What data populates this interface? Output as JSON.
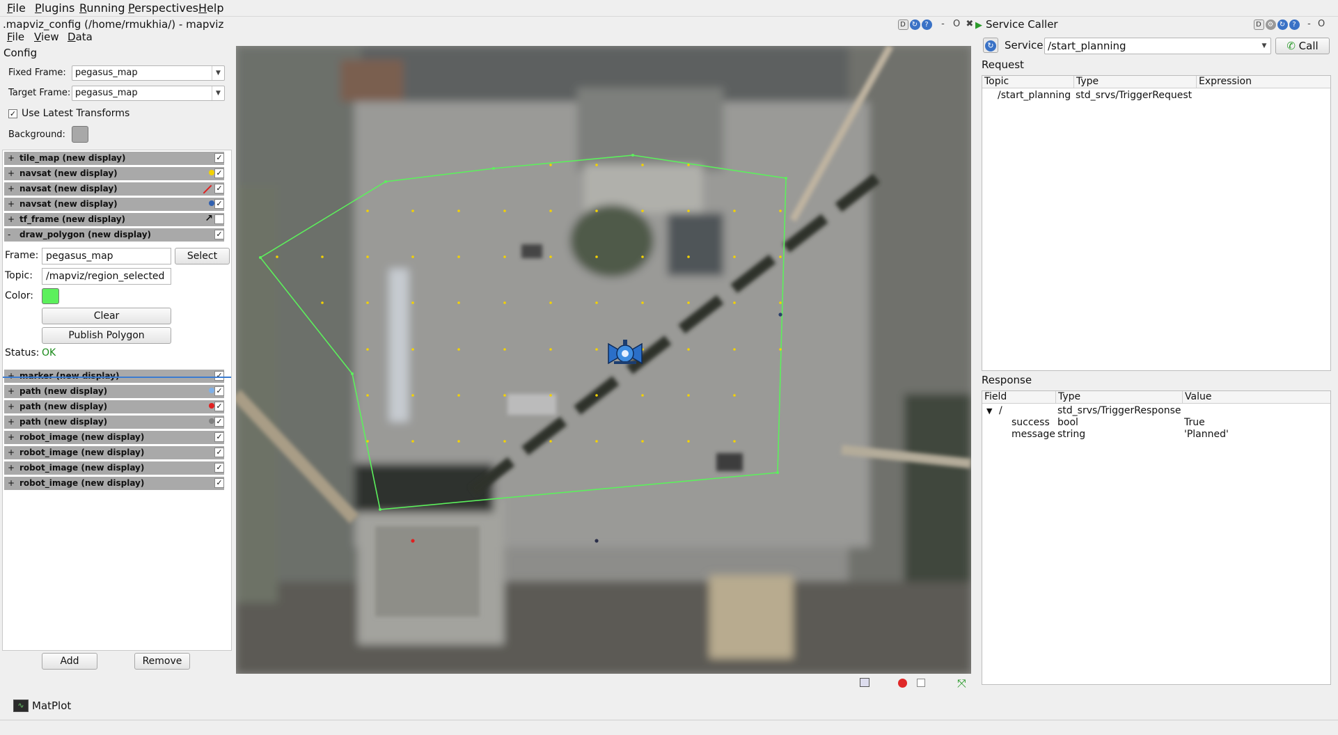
{
  "menubar": {
    "items": [
      {
        "label": "File",
        "u": "F",
        "rest": "ile"
      },
      {
        "label": "Plugins",
        "u": "P",
        "rest": "lugins"
      },
      {
        "label": "Running",
        "u": "R",
        "rest": "unning"
      },
      {
        "label": "Perspectives",
        "u": "P",
        "rest": "erspectives"
      },
      {
        "label": "Help",
        "u": "H",
        "rest": "elp"
      }
    ]
  },
  "mapviz": {
    "window_title": ".mapviz_config (/home/rmukhia/) - mapviz",
    "menu": {
      "file": {
        "u": "F",
        "rest": "ile"
      },
      "view": {
        "u": "V",
        "rest": "iew"
      },
      "data": {
        "u": "D",
        "rest": "ata"
      }
    },
    "config_label": "Config",
    "fixed_frame_label": "Fixed Frame:",
    "fixed_frame_value": "pegasus_map",
    "target_frame_label": "Target Frame:",
    "target_frame_value": "pegasus_map",
    "use_latest_label": "Use Latest Transforms",
    "use_latest_checked": true,
    "background_label": "Background:",
    "background_color": "#a8a8a8",
    "add_button": "Add",
    "remove_button": "Remove"
  },
  "layers_top": [
    {
      "pm": "+",
      "name": "tile_map (new display)",
      "icon": "none",
      "checked": true
    },
    {
      "pm": "+",
      "name": "navsat (new display)",
      "icon": "dot",
      "icon_color": "#f3d200",
      "checked": true
    },
    {
      "pm": "+",
      "name": "navsat (new display)",
      "icon": "line",
      "icon_color": "#e02020",
      "checked": true
    },
    {
      "pm": "+",
      "name": "navsat (new display)",
      "icon": "dot",
      "icon_color": "#3060b0",
      "checked": true
    },
    {
      "pm": "+",
      "name": "tf_frame (new display)",
      "icon": "arrow",
      "icon_color": "#111111",
      "checked": false
    },
    {
      "pm": "-",
      "name": "draw_polygon (new display)",
      "icon": "none",
      "checked": true
    }
  ],
  "draw_polygon": {
    "frame_label": "Frame:",
    "frame_value": "pegasus_map",
    "select_button": "Select",
    "topic_label": "Topic:",
    "topic_value": "/mapviz/region_selected",
    "color_label": "Color:",
    "color": "#5cf05c",
    "clear_button": "Clear",
    "publish_button": "Publish Polygon",
    "status_label": "Status:",
    "status_value": "OK",
    "status_color": "#1a8a1a"
  },
  "layers_bottom": [
    {
      "pm": "+",
      "name": "marker (new display)",
      "icon": "none",
      "checked": true
    },
    {
      "pm": "+",
      "name": "path (new display)",
      "icon": "dot",
      "icon_color": "#7fb0e8",
      "checked": true
    },
    {
      "pm": "+",
      "name": "path (new display)",
      "icon": "dot",
      "icon_color": "#e02020",
      "checked": true
    },
    {
      "pm": "+",
      "name": "path (new display)",
      "icon": "dot",
      "icon_color": "#808080",
      "checked": true
    },
    {
      "pm": "+",
      "name": "robot_image (new display)",
      "icon": "none",
      "checked": true
    },
    {
      "pm": "+",
      "name": "robot_image (new display)",
      "icon": "none",
      "checked": true
    },
    {
      "pm": "+",
      "name": "robot_image (new display)",
      "icon": "none",
      "checked": true
    },
    {
      "pm": "+",
      "name": "robot_image (new display)",
      "icon": "none",
      "checked": true
    }
  ],
  "service_caller": {
    "title": "Service Caller",
    "service_label": "Service",
    "service_value": "/start_planning",
    "call_button": "Call",
    "request_label": "Request",
    "request_headers": [
      "Topic",
      "Type",
      "Expression"
    ],
    "request_rows": [
      [
        "/start_planning",
        "std_srvs/TriggerRequest",
        ""
      ]
    ],
    "response_label": "Response",
    "response_headers": [
      "Field",
      "Type",
      "Value"
    ],
    "response_rows": [
      {
        "field": "/",
        "type": "std_srvs/TriggerResponse",
        "value": "",
        "indent": 0,
        "expander": "▼"
      },
      {
        "field": "success",
        "type": "bool",
        "value": "True",
        "indent": 1,
        "expander": ""
      },
      {
        "field": "message",
        "type": "string",
        "value": "'Planned'",
        "indent": 1,
        "expander": ""
      }
    ]
  },
  "bottom": {
    "matplot_label": "MatPlot"
  },
  "icons": {
    "dock_buttons": [
      "D",
      "refresh-icon",
      "help-icon"
    ],
    "robot": "robot-icon"
  }
}
